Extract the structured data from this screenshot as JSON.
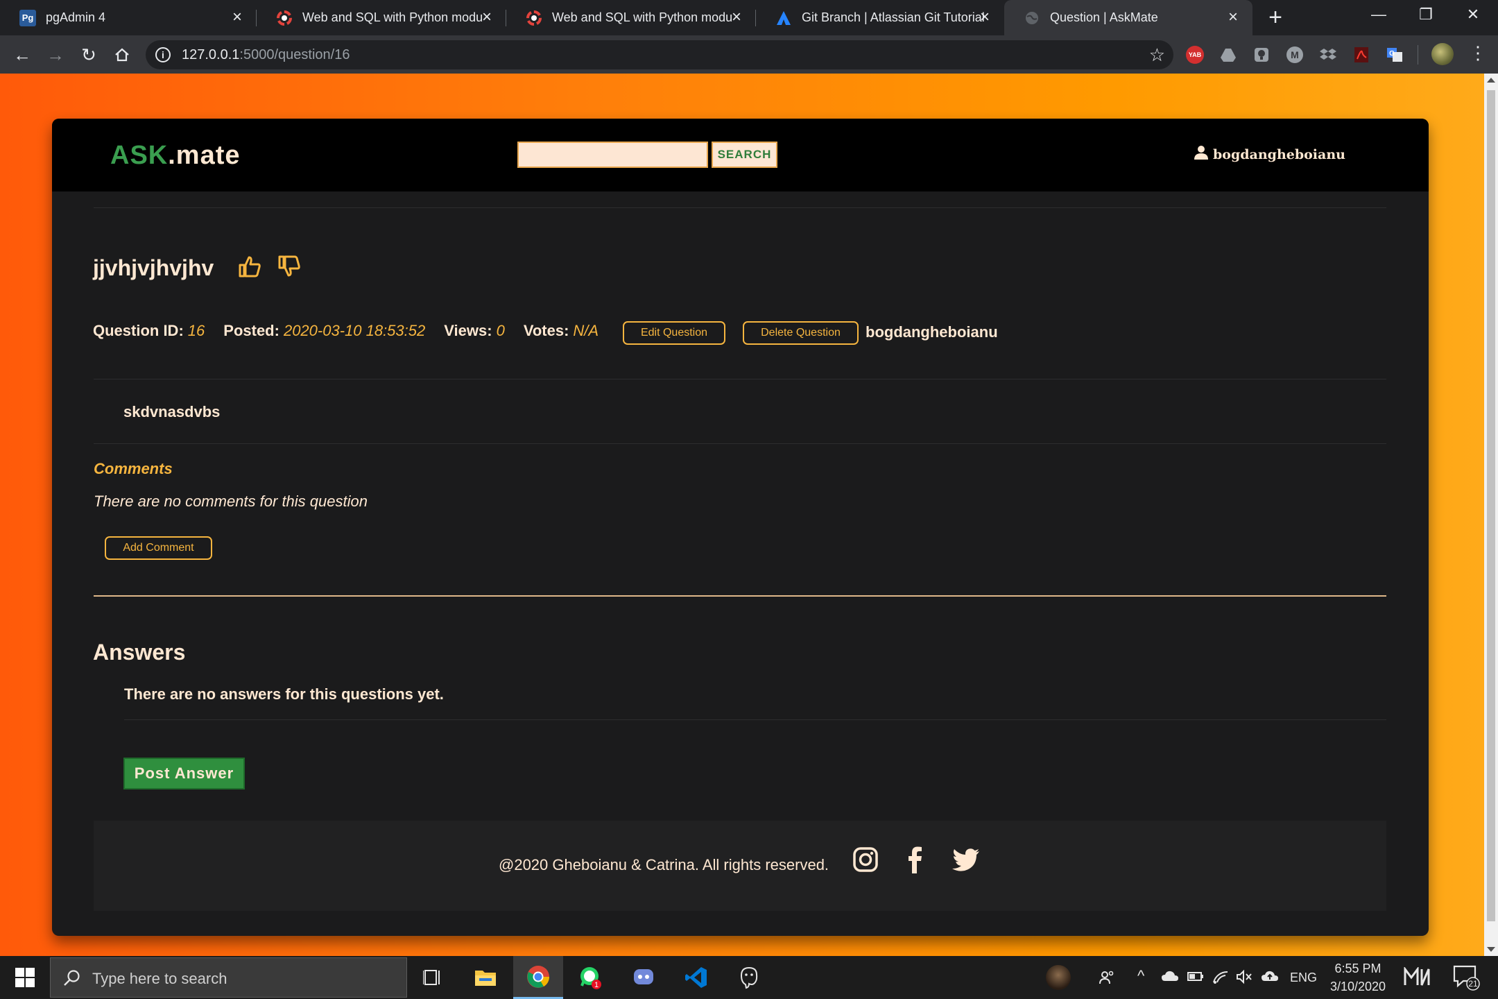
{
  "browser": {
    "tabs": [
      {
        "title": "pgAdmin 4",
        "favicon": "pgadmin-icon"
      },
      {
        "title": "Web and SQL with Python modul",
        "favicon": "codecool-icon"
      },
      {
        "title": "Web and SQL with Python modul",
        "favicon": "codecool-icon"
      },
      {
        "title": "Git Branch | Atlassian Git Tutorial",
        "favicon": "atlassian-icon"
      },
      {
        "title": "Question | AskMate",
        "favicon": "globe-icon",
        "active": true
      }
    ],
    "url_host": "127.0.0.1",
    "url_path": ":5000/question/16",
    "extensions": [
      "yab-icon",
      "drive-icon",
      "bulb-icon",
      "m-icon",
      "dropbox-icon",
      "pdf-icon",
      "translate-icon"
    ],
    "ext_yab_label": "YAB"
  },
  "site": {
    "logo_ask": "ASK",
    "logo_mate": ".mate",
    "search_placeholder": "",
    "search_button": "SEARCH",
    "username": "bogdangheboianu",
    "colors": {
      "accent": "#f6b53f",
      "text": "#ffe8d2",
      "green": "#2f8f3e",
      "card": "#1b1b1c"
    }
  },
  "question": {
    "title": "jjvhjvjhvjhv",
    "id_label": "Question ID:",
    "id": "16",
    "posted_label": "Posted:",
    "posted": "2020-03-10 18:53:52",
    "views_label": "Views:",
    "views": "0",
    "votes_label": "Votes:",
    "votes": "N/A",
    "edit_button": "Edit Question",
    "delete_button": "Delete Question",
    "author": "bogdangheboianu",
    "body": "skdvnasdvbs"
  },
  "comments": {
    "title": "Comments",
    "empty": "There are no comments for this question",
    "add_button": "Add Comment"
  },
  "answers": {
    "title": "Answers",
    "empty": "There are no answers for this questions yet.",
    "post_button": "Post Answer"
  },
  "footer": {
    "copyright": "@2020 Gheboianu & Catrina. All rights reserved.",
    "social": [
      "instagram-icon",
      "facebook-icon",
      "twitter-icon"
    ]
  },
  "taskbar": {
    "search_placeholder": "Type here to search",
    "apps": [
      "task-view-icon",
      "file-explorer-icon",
      "chrome-icon",
      "whatsapp-icon",
      "discord-icon",
      "vscode-icon",
      "postgres-icon"
    ],
    "whatsapp_badge": "1",
    "language": "ENG",
    "time": "6:55 PM",
    "date": "3/10/2020",
    "notifications": "21"
  }
}
